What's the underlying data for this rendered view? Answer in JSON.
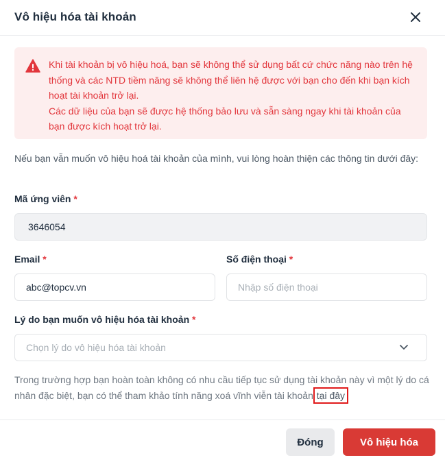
{
  "dialog": {
    "title": "Vô hiệu hóa tài khoản",
    "close_icon": "close-icon"
  },
  "alert": {
    "icon": "warning-triangle-icon",
    "color": "#e2363c",
    "background": "#fdeeee",
    "line1": "Khi tài khoản bị vô hiệu hoá, bạn sẽ không thể sử dụng bất cứ chức năng nào trên hệ thống và các NTD tiềm năng sẽ không thể liên hệ được với bạn cho đến khi bạn kích hoạt tài khoản trở lại.",
    "line2": "Các dữ liệu của bạn sẽ được hệ thống bảo lưu và sẵn sàng ngay khi tài khoản của bạn được kích hoạt trở lại."
  },
  "intro": "Nếu bạn vẫn muốn vô hiệu hoá tài khoản của mình, vui lòng hoàn thiện các thông tin dưới đây:",
  "fields": {
    "candidate_id": {
      "label": "Mã ứng viên",
      "required_mark": "*",
      "value": "3646054"
    },
    "email": {
      "label": "Email",
      "required_mark": "*",
      "value": "abc@topcv.vn"
    },
    "phone": {
      "label": "Số điện thoại",
      "required_mark": "*",
      "value": "",
      "placeholder": "Nhập số điện thoại"
    },
    "reason": {
      "label": "Lý do bạn muốn vô hiệu hóa tài khoản",
      "required_mark": "*",
      "selected": "Chọn lý do vô hiệu hóa tài khoản"
    }
  },
  "note": {
    "text": "Trong trường hợp bạn hoàn toàn không có nhu cầu tiếp tục sử dụng tài khoản này vì một lý do cá nhân đặc biệt, bạn có thể tham khảo tính năng xoá vĩnh viễn tài khoản ",
    "link": "tại đây"
  },
  "footer": {
    "close_label": "Đóng",
    "confirm_label": "Vô hiệu hóa",
    "confirm_color": "#d93a35"
  }
}
